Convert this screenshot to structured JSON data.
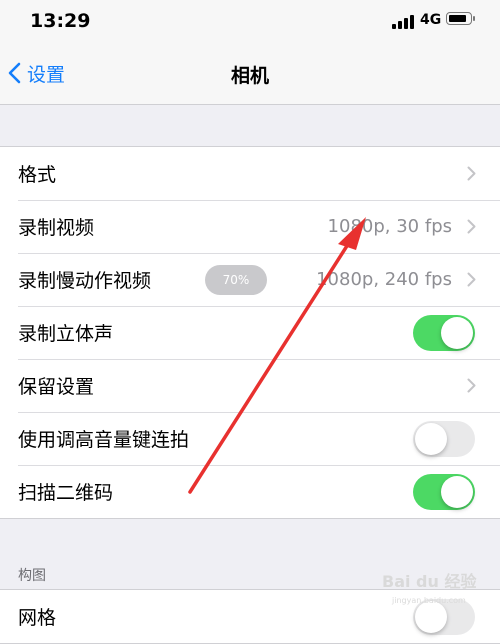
{
  "status_bar": {
    "time": "13:29",
    "network": "4G"
  },
  "nav": {
    "back_label": "设置",
    "title": "相机"
  },
  "settings": [
    {
      "label": "格式",
      "control": "chevron"
    },
    {
      "label": "录制视频",
      "value": "1080p, 30 fps",
      "control": "chevron"
    },
    {
      "label": "录制慢动作视频",
      "value": "1080p, 240 fps",
      "control": "chevron"
    },
    {
      "label": "录制立体声",
      "control": "toggle",
      "on": true
    },
    {
      "label": "保留设置",
      "control": "chevron"
    },
    {
      "label": "使用调高音量键连拍",
      "control": "toggle",
      "on": false
    },
    {
      "label": "扫描二维码",
      "control": "toggle",
      "on": true
    }
  ],
  "volume_overlay": "70%",
  "section2": {
    "header": "构图",
    "items": [
      {
        "label": "网格",
        "control": "toggle",
        "on": false
      }
    ]
  },
  "watermark": {
    "logo": "Bai du 经验",
    "url": "jingyan.baidu.com"
  },
  "colors": {
    "accent": "#147efb",
    "toggle_on": "#4cd964",
    "annotation_arrow": "#e8312f"
  }
}
